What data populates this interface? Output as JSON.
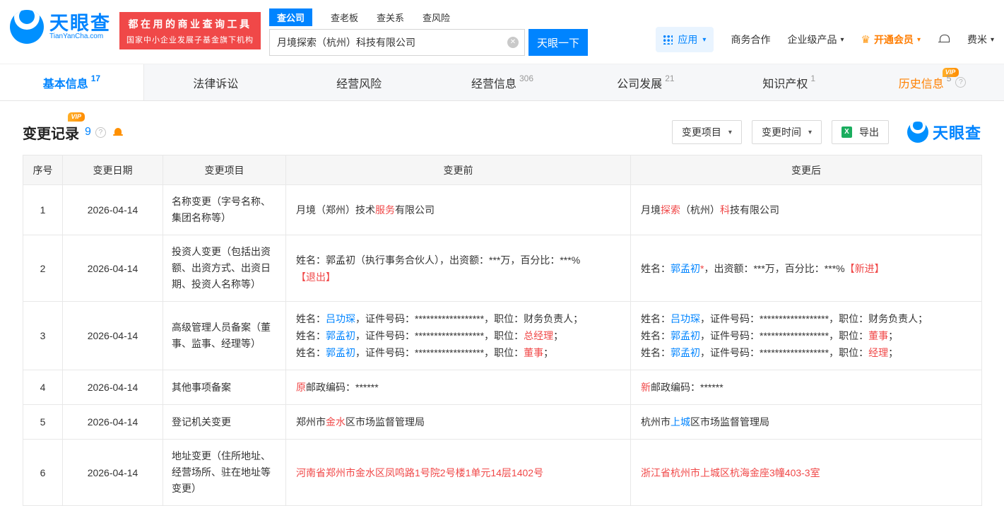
{
  "brand": {
    "name": "天眼查",
    "domain": "TianYanCha.com",
    "slogan_line1": "都在用的商业查询工具",
    "slogan_line2": "国家中小企业发展子基金旗下机构"
  },
  "icons": {
    "clear": "✕",
    "caret": "▾",
    "question": "?",
    "vip": "VIP",
    "export_x": "X",
    "crown": "♛"
  },
  "colors": {
    "primary": "#0084ff",
    "red": "#f04848",
    "orange": "#ff8000"
  },
  "search": {
    "tabs": [
      {
        "label": "查公司"
      },
      {
        "label": "查老板"
      },
      {
        "label": "查关系"
      },
      {
        "label": "查风险"
      }
    ],
    "value": "月境探索（杭州）科技有限公司",
    "button": "天眼一下"
  },
  "topnav": {
    "apps": "应用",
    "cooperation": "商务合作",
    "enterprise_products": "企业级产品",
    "vip": "开通会员",
    "user": "费米"
  },
  "tabs": [
    {
      "label": "基本信息",
      "count": "17"
    },
    {
      "label": "法律诉讼",
      "count": ""
    },
    {
      "label": "经营风险",
      "count": ""
    },
    {
      "label": "经营信息",
      "count": "306"
    },
    {
      "label": "公司发展",
      "count": "21"
    },
    {
      "label": "知识产权",
      "count": "1"
    },
    {
      "label": "历史信息",
      "count": "5"
    }
  ],
  "section": {
    "title": "变更记录",
    "count": "9",
    "filters": [
      {
        "label": "变更项目"
      },
      {
        "label": "变更时间"
      }
    ],
    "export_label": "导出",
    "watermark": "天眼查"
  },
  "table": {
    "headers": [
      "序号",
      "变更日期",
      "变更项目",
      "变更前",
      "变更后"
    ],
    "rows": [
      {
        "no": "1",
        "date": "2026-04-14",
        "item": "名称变更（字号名称、集团名称等）",
        "before": [
          [
            {
              "t": "月境（郑州）技术",
              "s": "n"
            },
            {
              "t": "服务",
              "s": "r"
            },
            {
              "t": "有限公司",
              "s": "n"
            }
          ]
        ],
        "after": [
          [
            {
              "t": "月境",
              "s": "n"
            },
            {
              "t": "探索",
              "s": "r"
            },
            {
              "t": "（杭州）",
              "s": "n"
            },
            {
              "t": "科",
              "s": "r"
            },
            {
              "t": "技有限公司",
              "s": "n"
            }
          ]
        ]
      },
      {
        "no": "2",
        "date": "2026-04-14",
        "item": "投资人变更（包括出资额、出资方式、出资日期、投资人名称等）",
        "before": [
          [
            {
              "t": "姓名：郭孟初（执行事务合伙人），出资额：***万，百分比：***%",
              "s": "n"
            }
          ],
          [
            {
              "t": "【退出】",
              "s": "r"
            }
          ]
        ],
        "after": [
          [
            {
              "t": "姓名：",
              "s": "n"
            },
            {
              "t": "郭孟初",
              "s": "l"
            },
            {
              "t": "*",
              "s": "r"
            },
            {
              "t": "，出资额：***万，百分比：***%",
              "s": "n"
            },
            {
              "t": "【新进】",
              "s": "r"
            }
          ]
        ]
      },
      {
        "no": "3",
        "date": "2026-04-14",
        "item": "高级管理人员备案（董事、监事、经理等）",
        "before": [
          [
            {
              "t": "姓名：",
              "s": "n"
            },
            {
              "t": "吕功琛",
              "s": "l"
            },
            {
              "t": "，证件号码：******************，职位：财务负责人；",
              "s": "n"
            }
          ],
          [
            {
              "t": "姓名：",
              "s": "n"
            },
            {
              "t": "郭孟初",
              "s": "l"
            },
            {
              "t": "，证件号码：******************，职位：",
              "s": "n"
            },
            {
              "t": "总经理",
              "s": "r"
            },
            {
              "t": "；",
              "s": "n"
            }
          ],
          [
            {
              "t": "姓名：",
              "s": "n"
            },
            {
              "t": "郭孟初",
              "s": "l"
            },
            {
              "t": "，证件号码：******************，职位：",
              "s": "n"
            },
            {
              "t": "董事",
              "s": "r"
            },
            {
              "t": "；",
              "s": "n"
            }
          ]
        ],
        "after": [
          [
            {
              "t": "姓名：",
              "s": "n"
            },
            {
              "t": "吕功琛",
              "s": "l"
            },
            {
              "t": "，证件号码：******************，职位：财务负责人；",
              "s": "n"
            }
          ],
          [
            {
              "t": "姓名：",
              "s": "n"
            },
            {
              "t": "郭孟初",
              "s": "l"
            },
            {
              "t": "，证件号码：******************，职位：",
              "s": "n"
            },
            {
              "t": "董事",
              "s": "r"
            },
            {
              "t": "；",
              "s": "n"
            }
          ],
          [
            {
              "t": "姓名：",
              "s": "n"
            },
            {
              "t": "郭孟初",
              "s": "l"
            },
            {
              "t": "，证件号码：******************，职位：",
              "s": "n"
            },
            {
              "t": "经理",
              "s": "r"
            },
            {
              "t": "；",
              "s": "n"
            }
          ]
        ]
      },
      {
        "no": "4",
        "date": "2026-04-14",
        "item": "其他事项备案",
        "before": [
          [
            {
              "t": "原",
              "s": "r"
            },
            {
              "t": "邮政编码：******",
              "s": "n"
            }
          ]
        ],
        "after": [
          [
            {
              "t": "新",
              "s": "r"
            },
            {
              "t": "邮政编码：******",
              "s": "n"
            }
          ]
        ]
      },
      {
        "no": "5",
        "date": "2026-04-14",
        "item": "登记机关变更",
        "before": [
          [
            {
              "t": "郑州市",
              "s": "n"
            },
            {
              "t": "金水",
              "s": "r"
            },
            {
              "t": "区市场监督管理局",
              "s": "n"
            }
          ]
        ],
        "after": [
          [
            {
              "t": "杭州市",
              "s": "n"
            },
            {
              "t": "上城",
              "s": "l"
            },
            {
              "t": "区市场监督管理局",
              "s": "n"
            }
          ]
        ]
      },
      {
        "no": "6",
        "date": "2026-04-14",
        "item": "地址变更（住所地址、经营场所、驻在地址等变更）",
        "before": [
          [
            {
              "t": "河南省郑州市金水区凤鸣路1号院2号楼1单元14层1402号",
              "s": "r"
            }
          ]
        ],
        "after": [
          [
            {
              "t": "浙江省杭州市上城区杭海金座3幢403-3室",
              "s": "r"
            }
          ]
        ]
      }
    ]
  }
}
